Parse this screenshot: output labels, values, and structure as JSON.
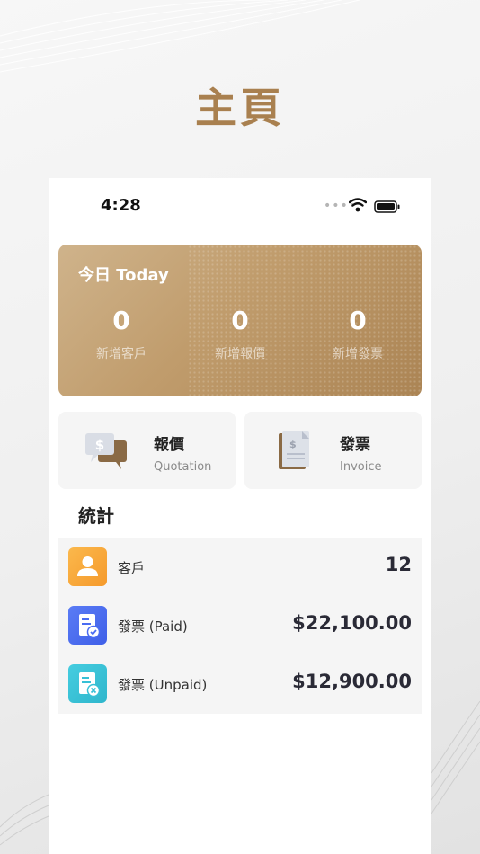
{
  "promo": {
    "title": "主頁"
  },
  "status_bar": {
    "time": "4:28"
  },
  "today": {
    "title": "今日 Today",
    "stats": [
      {
        "value": "0",
        "label": "新增客戶"
      },
      {
        "value": "0",
        "label": "新增報價"
      },
      {
        "value": "0",
        "label": "新增發票"
      }
    ]
  },
  "actions": {
    "quotation": {
      "title": "報價",
      "subtitle": "Quotation",
      "icon": "quotation-icon"
    },
    "invoice": {
      "title": "發票",
      "subtitle": "Invoice",
      "icon": "invoice-icon"
    }
  },
  "stats_section": {
    "title": "統計",
    "rows": [
      {
        "label": "客戶",
        "value": "12",
        "icon": "customer-icon",
        "color": "#f8a93e"
      },
      {
        "label": "發票 (Paid)",
        "value": "$22,100.00",
        "icon": "invoice-paid-icon",
        "color": "#4a6cf2"
      },
      {
        "label": "發票 (Unpaid)",
        "value": "$12,900.00",
        "icon": "invoice-unpaid-icon",
        "color": "#37c0d6"
      }
    ]
  },
  "colors": {
    "gold": "#a9804f",
    "card_gold": "#c09c6c"
  }
}
